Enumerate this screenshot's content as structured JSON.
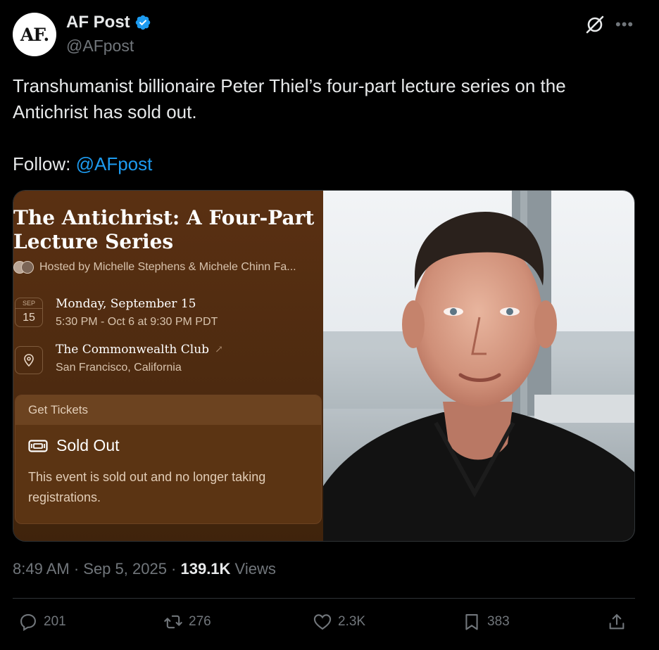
{
  "author": {
    "avatar_text": "AF.",
    "name": "AF Post",
    "handle": "@AFpost",
    "verified_icon": "verified-badge-icon"
  },
  "post": {
    "text": "Transhumanist billionaire Peter Thiel’s four-part lecture series on the Antichrist has sold out.",
    "follow_label": "Follow: ",
    "follow_link": "@AFpost"
  },
  "event_card": {
    "title": "The Antichrist: A Four-Part Lecture Series",
    "hosts": "Hosted by Michelle Stephens & Michele Chinn Fa...",
    "date_month": "SEP",
    "date_day": "15",
    "date_main": "Monday, September 15",
    "date_sub": "5:30 PM - Oct 6 at 9:30 PM PDT",
    "location_main": "The Commonwealth Club",
    "location_arrow": "↗",
    "location_sub": "San Francisco, California",
    "tickets_header": "Get Tickets",
    "sold_out_title": "Sold Out",
    "sold_out_desc": "This event is sold out and no longer taking registrations."
  },
  "meta": {
    "time": "8:49 AM · Sep 5, 2025 · ",
    "views_count": "139.1K",
    "views_label": " Views"
  },
  "actions": {
    "replies": "201",
    "reposts": "276",
    "likes": "2.3K",
    "bookmarks": "383"
  },
  "colors": {
    "background": "#000000",
    "link": "#1d9bf0",
    "verified": "#1d9bf0",
    "muted": "#71767b",
    "event_card_bg": "#4c2a10"
  }
}
